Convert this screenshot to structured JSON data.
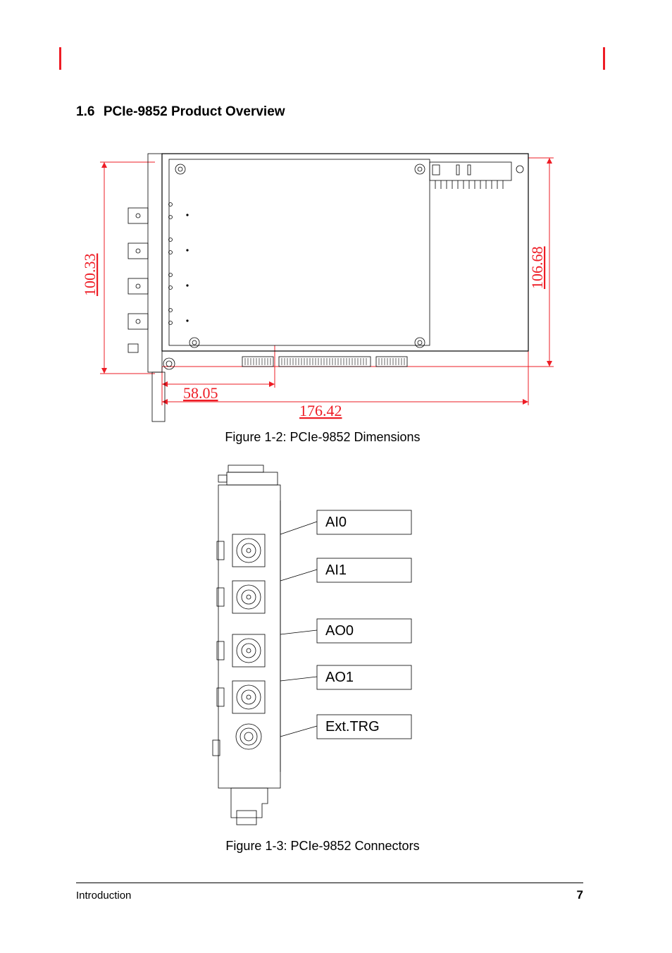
{
  "section_number": "1.6",
  "section_title": "PCIe-9852 Product Overview",
  "dimensions": {
    "height_left": "100.33",
    "height_right": "106.68",
    "width_partial": "58.05",
    "width_full": "176.42"
  },
  "figure1_caption": "Figure 1-2: PCIe-9852 Dimensions",
  "connectors": {
    "ai0": "AI0",
    "ai1": "AI1",
    "ao0": "AO0",
    "ao1": "AO1",
    "ext_trg": "Ext.TRG"
  },
  "figure2_caption": "Figure 1-3: PCIe-9852 Connectors",
  "footer_left": "Introduction",
  "footer_right": "7"
}
